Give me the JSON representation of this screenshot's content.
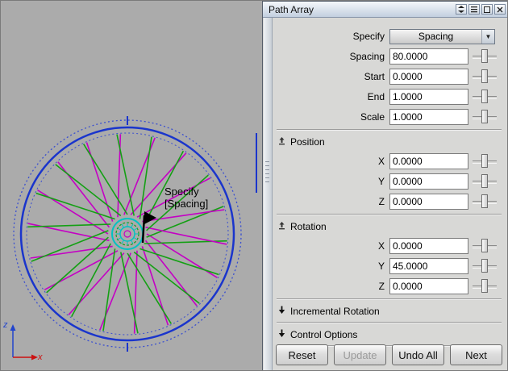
{
  "panel": {
    "title": "Path Array",
    "specify": {
      "label": "Specify",
      "value": "Spacing"
    },
    "fields": [
      {
        "label": "Spacing",
        "value": "80.0000"
      },
      {
        "label": "Start",
        "value": "0.0000"
      },
      {
        "label": "End",
        "value": "1.0000"
      },
      {
        "label": "Scale",
        "value": "1.0000"
      }
    ],
    "position": {
      "title": "Position",
      "axes": [
        {
          "label": "X",
          "value": "0.0000"
        },
        {
          "label": "Y",
          "value": "0.0000"
        },
        {
          "label": "Z",
          "value": "0.0000"
        }
      ]
    },
    "rotation": {
      "title": "Rotation",
      "axes": [
        {
          "label": "X",
          "value": "0.0000"
        },
        {
          "label": "Y",
          "value": "45.0000"
        },
        {
          "label": "Z",
          "value": "0.0000"
        }
      ]
    },
    "sections": [
      {
        "label": "Incremental Rotation"
      },
      {
        "label": "Control Options"
      }
    ],
    "buttons": [
      {
        "label": "Reset"
      },
      {
        "label": "Update"
      },
      {
        "label": "Undo All"
      },
      {
        "label": "Next"
      }
    ]
  },
  "viewport": {
    "annotation": {
      "line1": "Specify",
      "line2": "[Spacing]"
    },
    "axes": {
      "x": "x",
      "z": "z"
    },
    "colors": {
      "background": "#ababab",
      "rim": "#1a35cc",
      "rim_dotted": "#3a4fd0",
      "spoke_a": "#c400c4",
      "spoke_b": "#14a014",
      "hub": "#00c2c2",
      "hub_dash": "#14a014",
      "marker": "#000000",
      "axis_x": "#cc1111",
      "axis_z": "#2244cc"
    }
  }
}
